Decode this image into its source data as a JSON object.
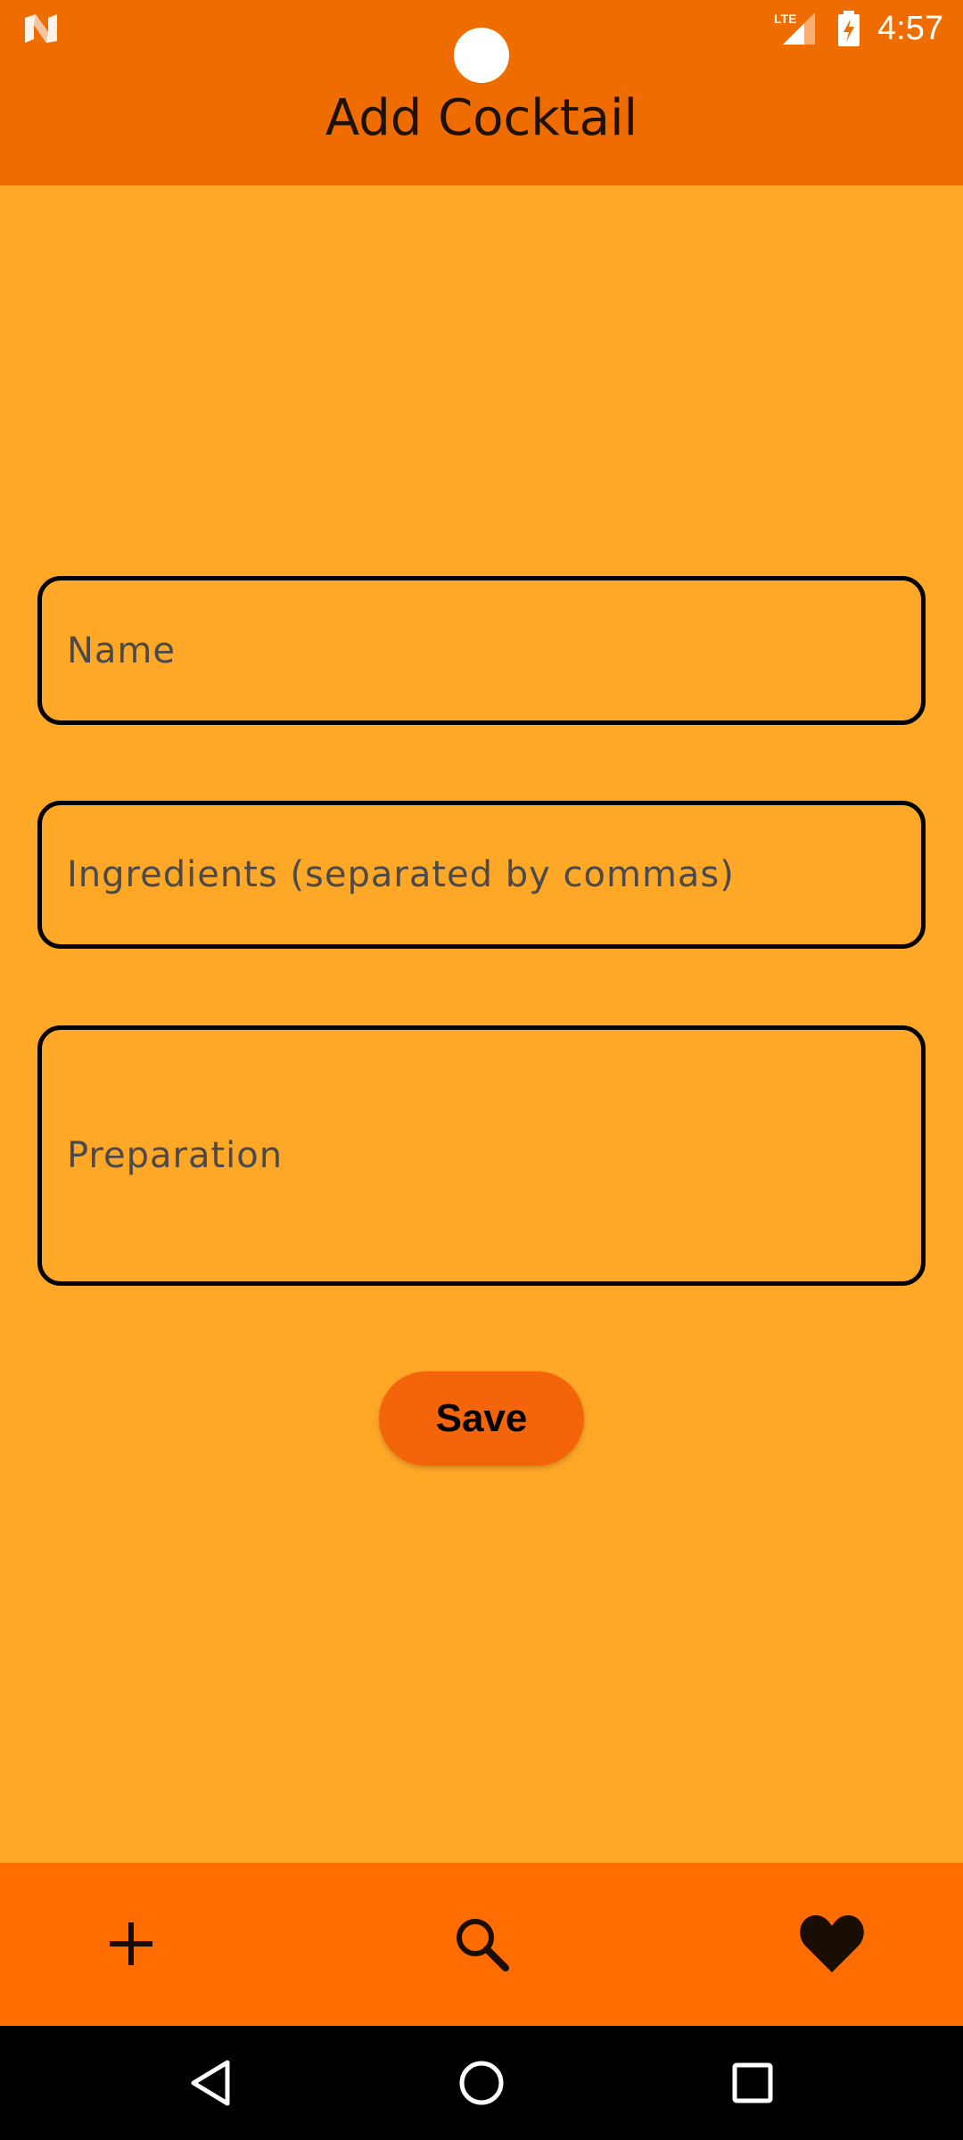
{
  "status_bar": {
    "time": "4:57",
    "network": "LTE",
    "icons": [
      "app-logo-icon",
      "signal-icon",
      "battery-charging-icon"
    ]
  },
  "app_bar": {
    "title": "Add Cocktail"
  },
  "form": {
    "name_label": "Name",
    "ingredients_label": "Ingredients (separated by commas)",
    "preparation_label": "Preparation",
    "save_label": "Save"
  },
  "bottom_nav": {
    "items": [
      {
        "name": "add",
        "icon": "plus-icon"
      },
      {
        "name": "search",
        "icon": "search-icon"
      },
      {
        "name": "favorites",
        "icon": "heart-icon"
      }
    ]
  },
  "system_nav": {
    "icons": [
      "back-icon",
      "home-icon",
      "recents-icon"
    ]
  },
  "colors": {
    "background": "#FFA726",
    "app_bar": "#EF6C00",
    "bottom_nav": "#FF6D00",
    "save_button": "#F4640A",
    "field_border": "#000000"
  }
}
